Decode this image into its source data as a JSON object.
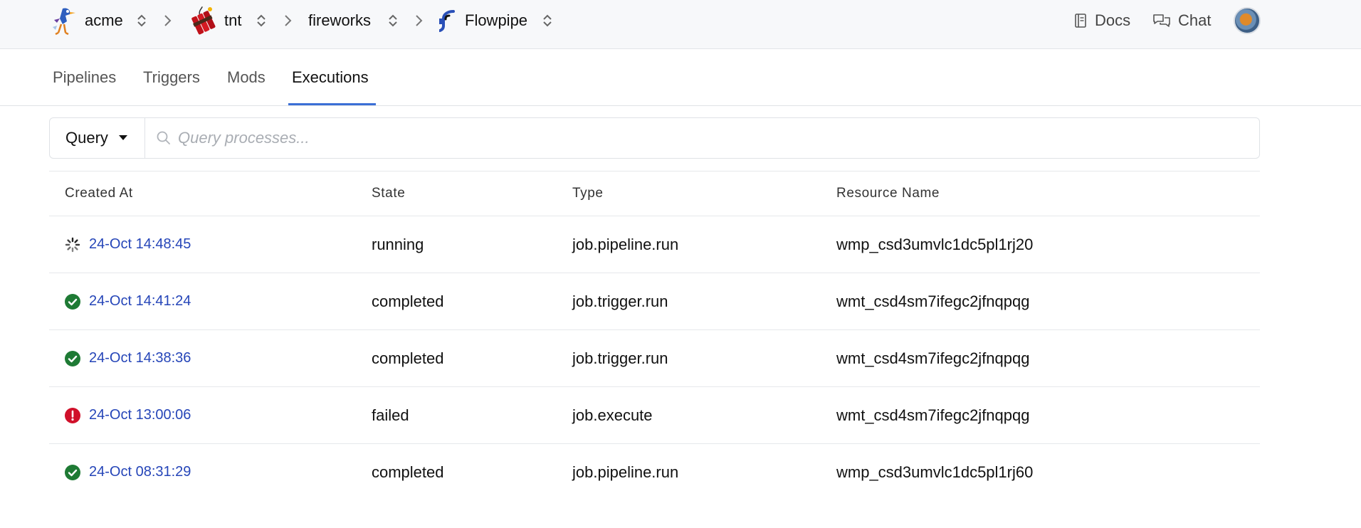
{
  "breadcrumb": {
    "items": [
      {
        "label": "acme",
        "icon": "roadrunner-logo-icon"
      },
      {
        "label": "tnt",
        "icon": "tnt-dynamite-icon"
      },
      {
        "label": "fireworks",
        "icon": ""
      },
      {
        "label": "Flowpipe",
        "icon": "flowpipe-logo-icon"
      }
    ]
  },
  "header": {
    "docs_label": "Docs",
    "chat_label": "Chat",
    "avatar_icon": "user-avatar"
  },
  "tabs": [
    {
      "label": "Pipelines",
      "active": false
    },
    {
      "label": "Triggers",
      "active": false
    },
    {
      "label": "Mods",
      "active": false
    },
    {
      "label": "Executions",
      "active": true
    }
  ],
  "query": {
    "button_label": "Query",
    "placeholder": "Query processes...",
    "value": ""
  },
  "table": {
    "columns": [
      "Created At",
      "State",
      "Type",
      "Resource Name"
    ],
    "rows": [
      {
        "status_icon": "spinner-icon",
        "created_at": "24-Oct 14:48:45",
        "state": "running",
        "type": "job.pipeline.run",
        "resource": "wmp_csd3umvlc1dc5pl1rj20"
      },
      {
        "status_icon": "check-circle-icon",
        "created_at": "24-Oct 14:41:24",
        "state": "completed",
        "type": "job.trigger.run",
        "resource": "wmt_csd4sm7ifegc2jfnqpqg"
      },
      {
        "status_icon": "check-circle-icon",
        "created_at": "24-Oct 14:38:36",
        "state": "completed",
        "type": "job.trigger.run",
        "resource": "wmt_csd4sm7ifegc2jfnqpqg"
      },
      {
        "status_icon": "error-circle-icon",
        "created_at": "24-Oct 13:00:06",
        "state": "failed",
        "type": "job.execute",
        "resource": "wmt_csd4sm7ifegc2jfnqpqg"
      },
      {
        "status_icon": "check-circle-icon",
        "created_at": "24-Oct 08:31:29",
        "state": "completed",
        "type": "job.pipeline.run",
        "resource": "wmp_csd3umvlc1dc5pl1rj60"
      }
    ]
  },
  "colors": {
    "link": "#2545b8",
    "success": "#1e7a34",
    "error": "#d0102a",
    "tab_active": "#3b6fd6"
  }
}
